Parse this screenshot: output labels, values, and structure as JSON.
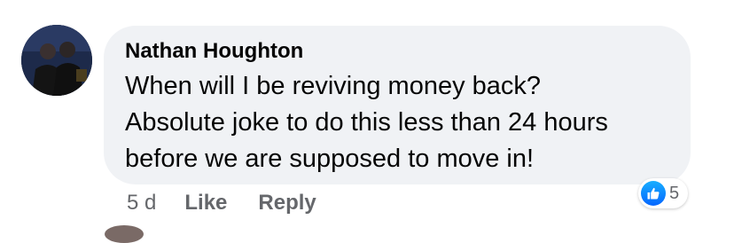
{
  "comment": {
    "author": "Nathan Houghton",
    "text": "When will I be reviving money back?\nAbsolute joke to do this less than 24 hours\nbefore we are supposed to move in!",
    "time": "5 d",
    "like_label": "Like",
    "reply_label": "Reply",
    "reaction_count": "5",
    "reaction_icon": "like-thumbs-up-icon"
  },
  "colors": {
    "bubble_bg": "#f0f2f5",
    "meta_text": "#65676b",
    "like_blue": "#0566ff"
  }
}
